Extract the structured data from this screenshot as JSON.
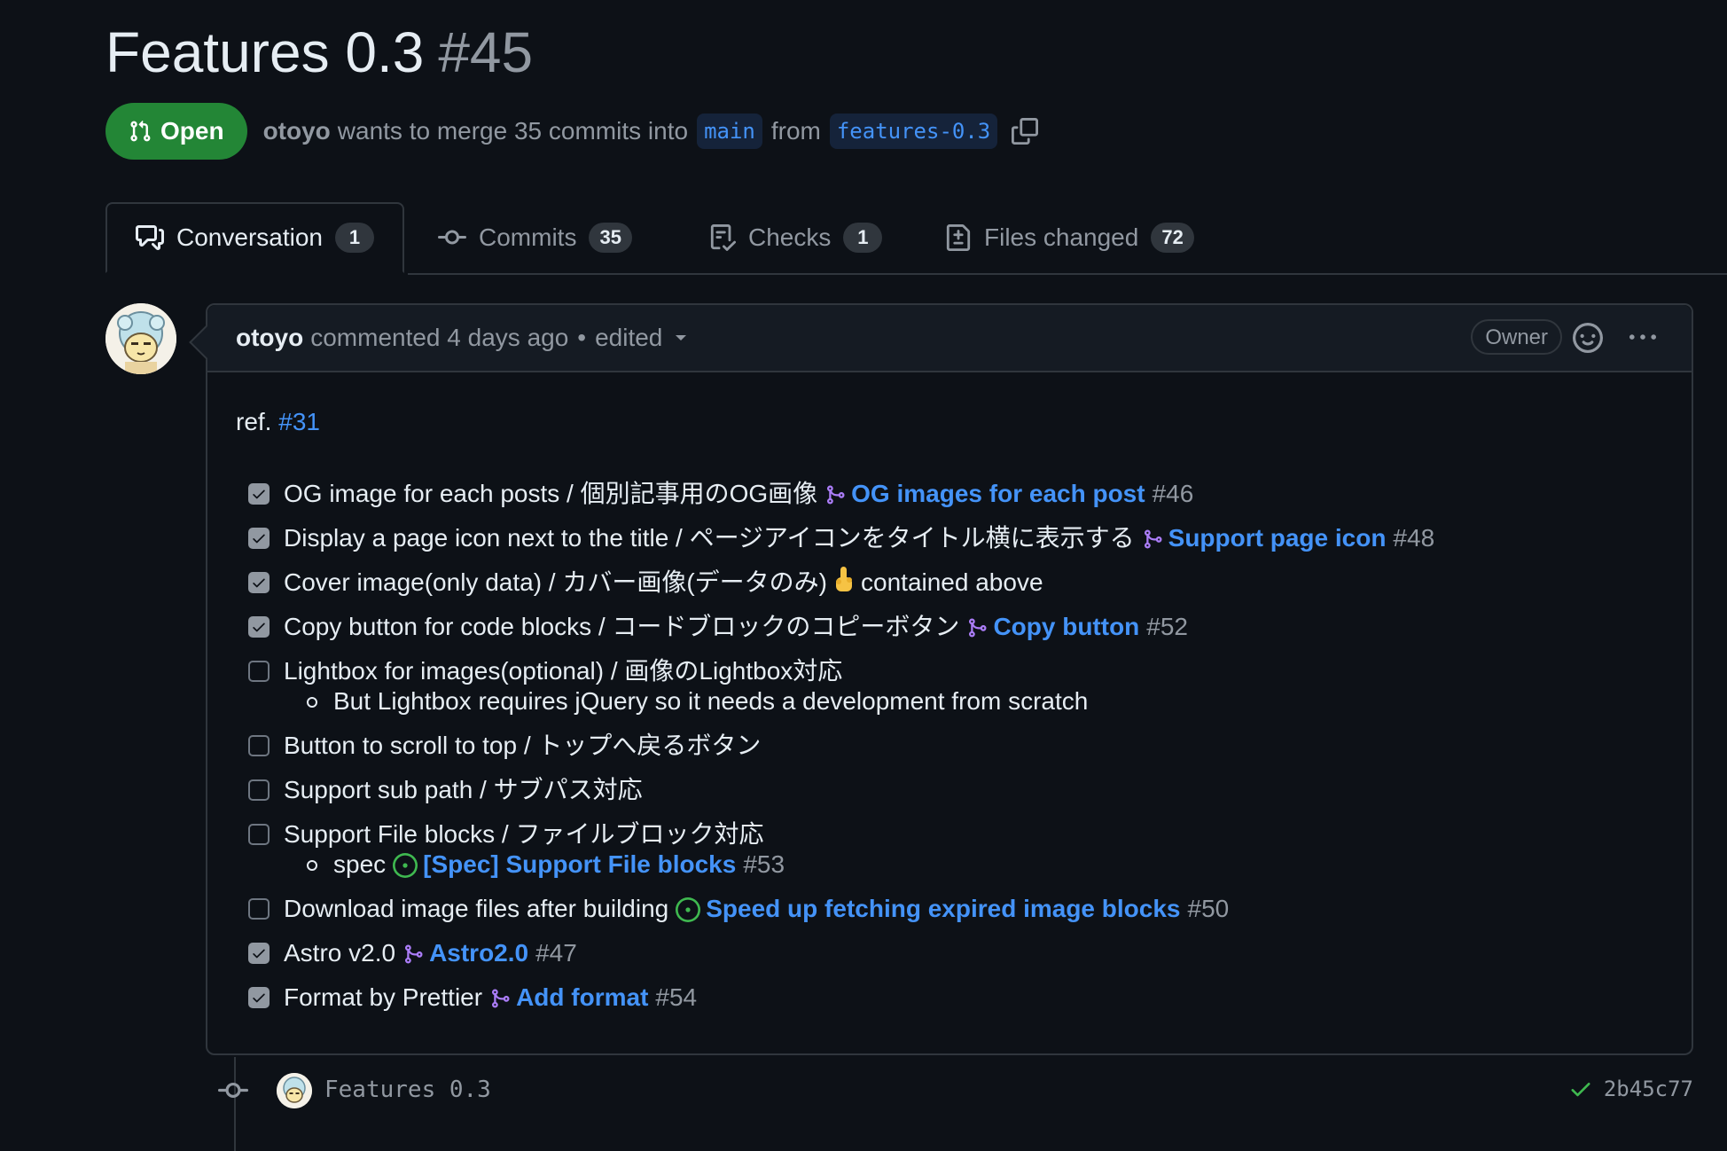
{
  "pr": {
    "title": "Features 0.3",
    "number": "#45",
    "state": "Open",
    "author": "otoyo",
    "merge_text": "wants to merge 35 commits into",
    "base_branch": "main",
    "from_text": "from",
    "head_branch": "features-0.3"
  },
  "tabs": [
    {
      "label": "Conversation",
      "count": "1"
    },
    {
      "label": "Commits",
      "count": "35"
    },
    {
      "label": "Checks",
      "count": "1"
    },
    {
      "label": "Files changed",
      "count": "72"
    }
  ],
  "comment": {
    "author": "otoyo",
    "action": "commented 4 days ago",
    "separator": "•",
    "edited": "edited",
    "role_badge": "Owner",
    "ref_text": "ref.",
    "ref_link": "#31",
    "tasks": [
      {
        "text": "OG image for each posts / 個別記事用のOG画像",
        "pr_title": "OG images for each post",
        "pr_num": "#46"
      },
      {
        "text": "Display a page icon next to the title / ページアイコンをタイトル横に表示する",
        "pr_title": "Support page icon",
        "pr_num": "#48"
      },
      {
        "text": "Cover image(only data) / カバー画像(データのみ)",
        "extra": "contained above"
      },
      {
        "text": "Copy button for code blocks / コードブロックのコピーボタン",
        "pr_title": "Copy button",
        "pr_num": "#52"
      },
      {
        "text": "Lightbox for images(optional) / 画像のLightbox対応",
        "sub": "But Lightbox requires jQuery so it needs a development from scratch"
      },
      {
        "text": "Button to scroll to top / トップへ戻るボタン"
      },
      {
        "text": "Support sub path / サブパス対応"
      },
      {
        "text": "Support File blocks / ファイルブロック対応",
        "sub_text": "spec",
        "sub_issue_title": "[Spec] Support File blocks",
        "sub_issue_num": "#53"
      },
      {
        "text": "Download image files after building",
        "issue_title": "Speed up fetching expired image blocks",
        "issue_num": "#50"
      },
      {
        "text": "Astro v2.0",
        "pr_title": "Astro2.0",
        "pr_num": "#47"
      },
      {
        "text": "Format by Prettier",
        "pr_title": "Add format",
        "pr_num": "#54"
      }
    ]
  },
  "commit": {
    "message": "Features 0.3",
    "sha": "2b45c77"
  },
  "colors": {
    "open_green": "#238636",
    "link_blue": "#4493f8",
    "pr_purple": "#ab7df8",
    "issue_green": "#3fb950"
  }
}
